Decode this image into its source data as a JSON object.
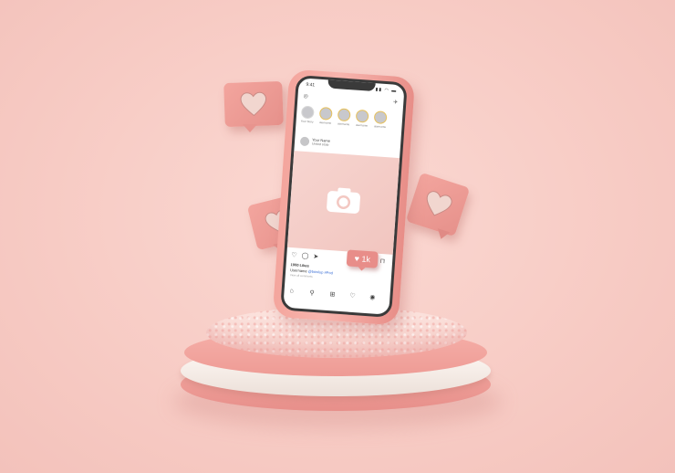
{
  "phone": {
    "status_time": "9:41",
    "status_icons": "▮▮ ◠ ▬",
    "header_left_icon": "camera-icon",
    "header_right_icon": "send-icon",
    "stories": [
      {
        "label": "Your Story",
        "own": true
      },
      {
        "label": "username"
      },
      {
        "label": "username"
      },
      {
        "label": "username"
      },
      {
        "label": "username"
      }
    ],
    "post_user": "Your Name",
    "post_location": "United state",
    "likes": "1000 Likes",
    "caption_user": "Username",
    "caption_tag": "@bowlup #Pod",
    "caption_sub": "View all comments",
    "like_badge": "♥ 1k",
    "nav_icons": [
      "home-icon",
      "search-icon",
      "add-icon",
      "heart-icon",
      "profile-icon"
    ]
  },
  "colors": {
    "background": "#f7cbc4",
    "accent": "#e88d89",
    "podium_white": "#fffaf6"
  }
}
